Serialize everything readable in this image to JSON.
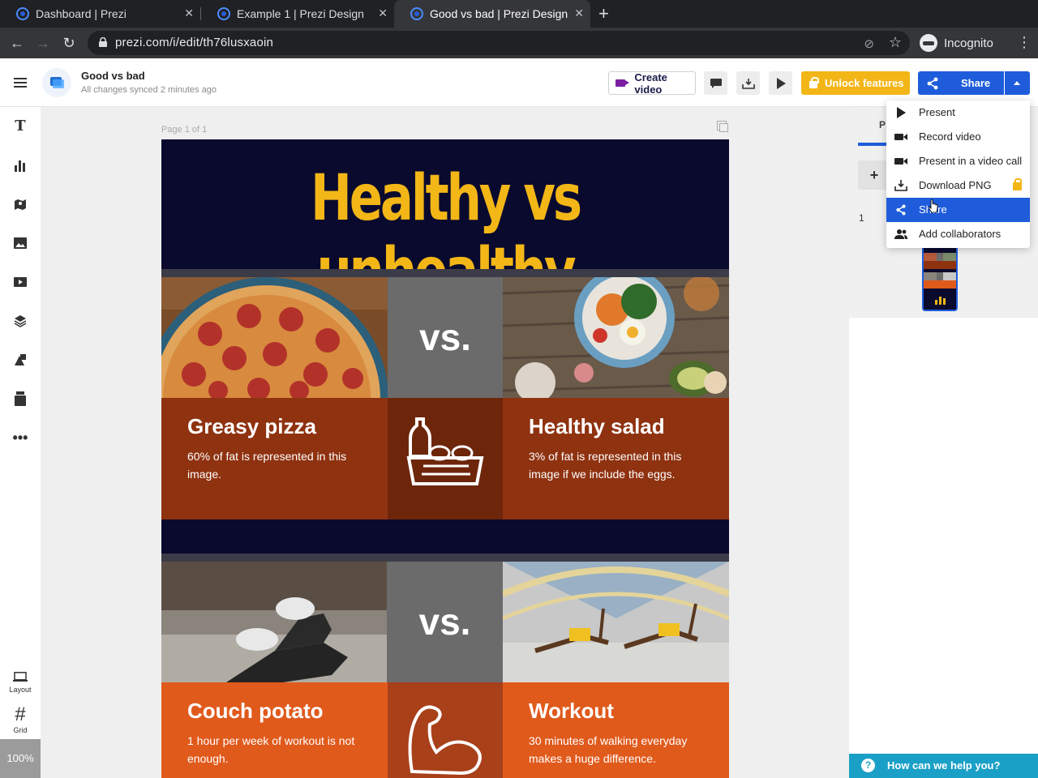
{
  "browser": {
    "tabs": [
      {
        "title": "Dashboard | Prezi"
      },
      {
        "title": "Example 1 | Prezi Design"
      },
      {
        "title": "Good vs bad | Prezi Design"
      }
    ],
    "url": "prezi.com/i/edit/th76lusxaoin",
    "profile": "Incognito"
  },
  "header": {
    "doc_title": "Good vs bad",
    "sync_status": "All changes synced 2 minutes ago",
    "create_video": "Create video",
    "unlock": "Unlock features",
    "share": "Share"
  },
  "rail": {
    "layout_label": "Layout",
    "grid_label": "Grid",
    "zoom": "100%"
  },
  "canvas": {
    "page_label": "Page 1 of 1"
  },
  "slide": {
    "title": "Healthy vs unhealthy",
    "vs_label": "vs.",
    "rows": [
      {
        "left": {
          "heading": "Greasy pizza",
          "desc": "60% of fat is represented in this image."
        },
        "right": {
          "heading": "Healthy salad",
          "desc": "3% of fat is represented in this image if we include the eggs."
        }
      },
      {
        "left": {
          "heading": "Couch potato",
          "desc": "1 hour per week of workout is not enough."
        },
        "right": {
          "heading": "Workout",
          "desc": "30 minutes of walking everyday makes a huge difference."
        }
      }
    ]
  },
  "sidepanel": {
    "tab_initial": "P",
    "add": "+",
    "page_number": "1",
    "help": "How can we help you?"
  },
  "share_menu": {
    "items": [
      {
        "label": "Present",
        "icon": "play-icon"
      },
      {
        "label": "Record video",
        "icon": "camera-icon"
      },
      {
        "label": "Present in a video call",
        "icon": "camera-icon"
      },
      {
        "label": "Download PNG",
        "icon": "download-icon",
        "locked": true
      },
      {
        "label": "Share",
        "icon": "share-icon",
        "highlighted": true
      },
      {
        "label": "Add collaborators",
        "icon": "users-icon"
      }
    ]
  },
  "colors": {
    "accent": "#1e5cdb",
    "gold": "#f3b617",
    "navy": "#0a0a2e",
    "rust": "#8f3210",
    "orange": "#e05a1c"
  }
}
